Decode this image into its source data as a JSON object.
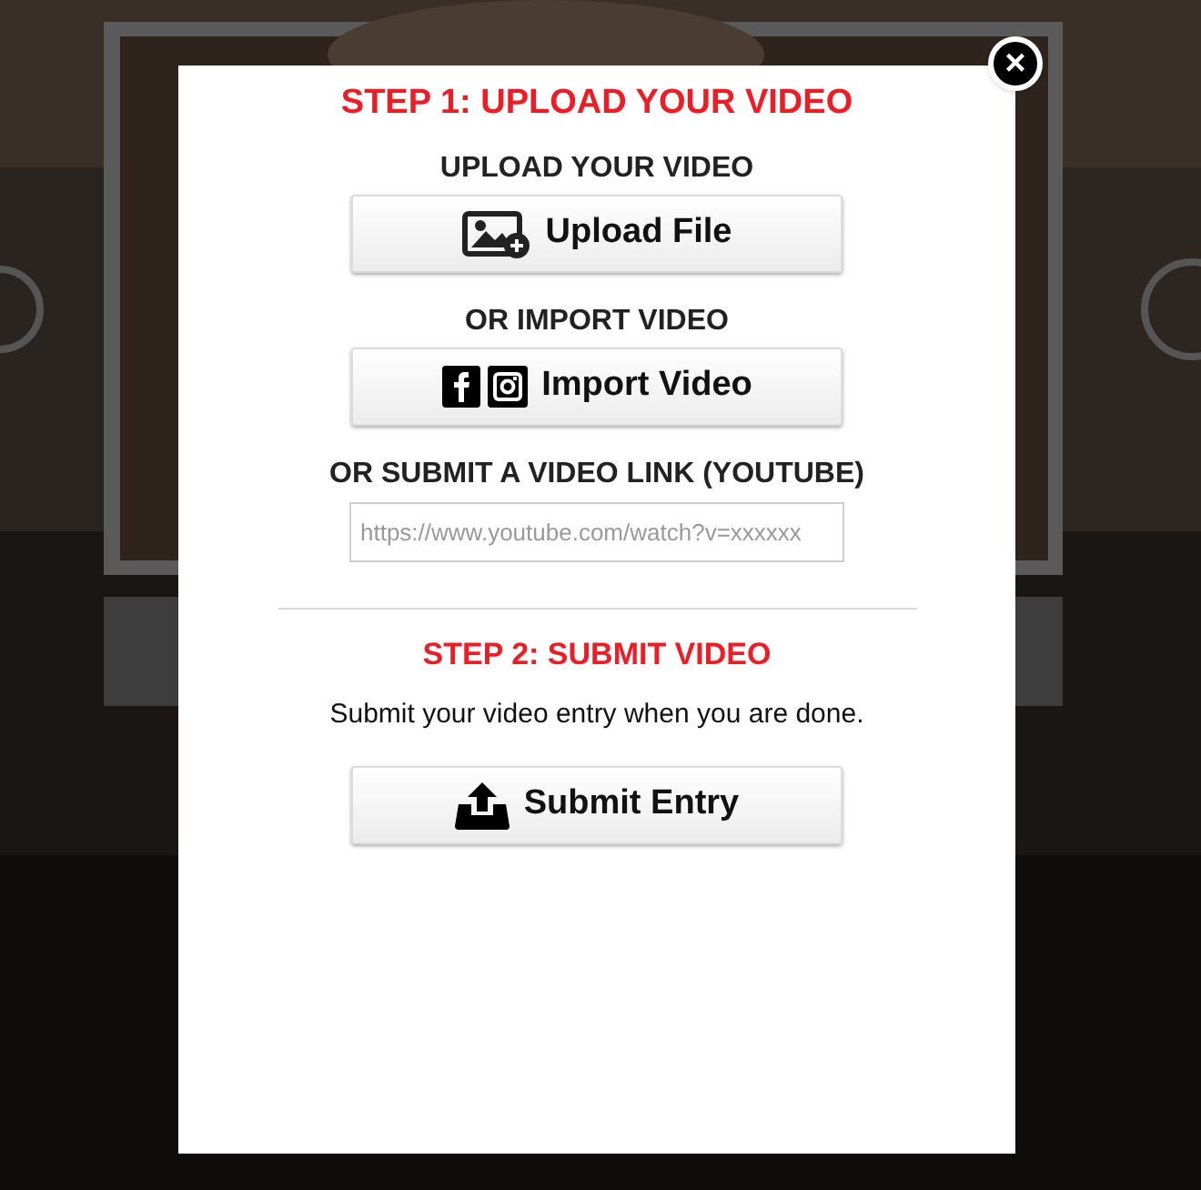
{
  "modal": {
    "close": "×",
    "step1": {
      "title": "STEP 1: UPLOAD YOUR VIDEO",
      "items": [
        {
          "kind": "label",
          "text": "UPLOAD YOUR VIDEO"
        },
        {
          "kind": "button",
          "label": "Upload File"
        },
        {
          "kind": "label",
          "text": "OR IMPORT VIDEO"
        },
        {
          "kind": "button",
          "label": "Import Video"
        },
        {
          "kind": "label",
          "text": "OR SUBMIT A VIDEO LINK (YOUTUBE)"
        },
        {
          "kind": "input",
          "placeholder": "https://www.youtube.com/watch?v=xxxxxx"
        }
      ]
    },
    "step2": {
      "title": "STEP 2: SUBMIT VIDEO",
      "text": "Submit your video entry when you are done.",
      "button": {
        "label": "Submit Entry"
      }
    }
  }
}
